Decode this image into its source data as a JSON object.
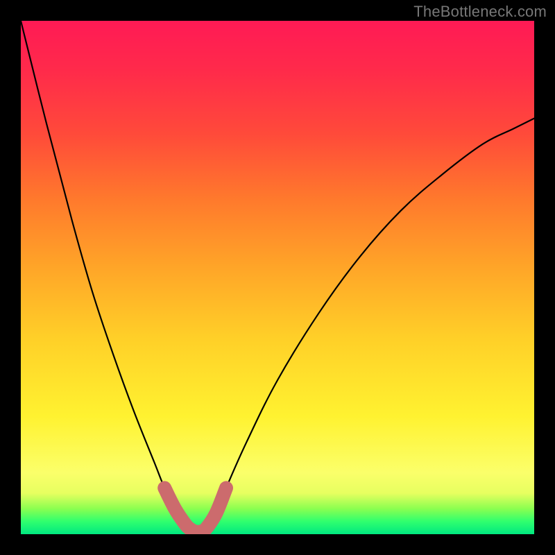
{
  "watermark": "TheBottleneck.com",
  "chart_data": {
    "type": "line",
    "title": "",
    "xlabel": "",
    "ylabel": "",
    "xlim": [
      0,
      100
    ],
    "ylim": [
      0,
      100
    ],
    "grid": false,
    "legend": false,
    "series": [
      {
        "name": "curve",
        "x": [
          0,
          5,
          10,
          14,
          18,
          22,
          26,
          28,
          30,
          32,
          33,
          34,
          35,
          36,
          38,
          40,
          44,
          50,
          58,
          66,
          74,
          82,
          90,
          96,
          100
        ],
        "values": [
          100,
          80,
          61,
          47,
          35,
          24,
          14,
          9,
          5,
          2,
          1,
          0.5,
          0.5,
          1,
          4,
          9,
          18,
          30,
          43,
          54,
          63,
          70,
          76,
          79,
          81
        ]
      }
    ],
    "marker_band": {
      "name": "optimal-range",
      "x": [
        28,
        30,
        32,
        33,
        34,
        35,
        36,
        38,
        40
      ],
      "values": [
        9,
        5,
        2,
        1,
        0.5,
        0.5,
        1,
        4,
        9
      ]
    },
    "background_gradient": {
      "stops": [
        {
          "pos": 0.0,
          "color": "#ff1a55"
        },
        {
          "pos": 0.35,
          "color": "#ff7a2c"
        },
        {
          "pos": 0.62,
          "color": "#ffd028"
        },
        {
          "pos": 0.88,
          "color": "#fbff6a"
        },
        {
          "pos": 1.0,
          "color": "#00e880"
        }
      ]
    }
  }
}
